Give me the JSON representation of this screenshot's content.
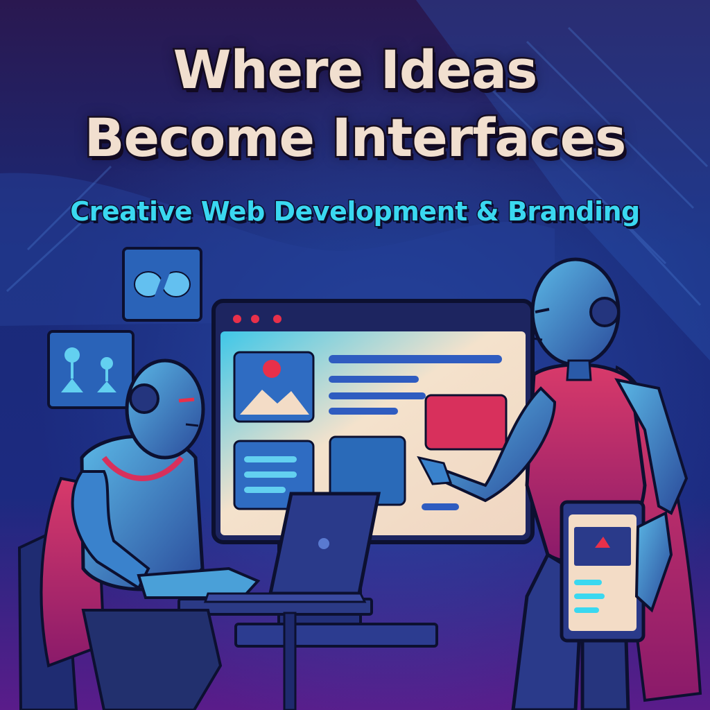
{
  "headline": {
    "line1": "Where Ideas",
    "line2": "Become Interfaces"
  },
  "tagline": "Creative Web Development & Branding",
  "icons": [
    "code-icon",
    "nodes-icon"
  ],
  "colors": {
    "text_cream": "#f1dfcf",
    "tagline_cyan": "#3ad8f0",
    "bg_navy": "#151a4a",
    "bg_purple": "#3a1a6a",
    "accent_magenta": "#d8305c",
    "screen_cream": "#f3dcc6"
  }
}
